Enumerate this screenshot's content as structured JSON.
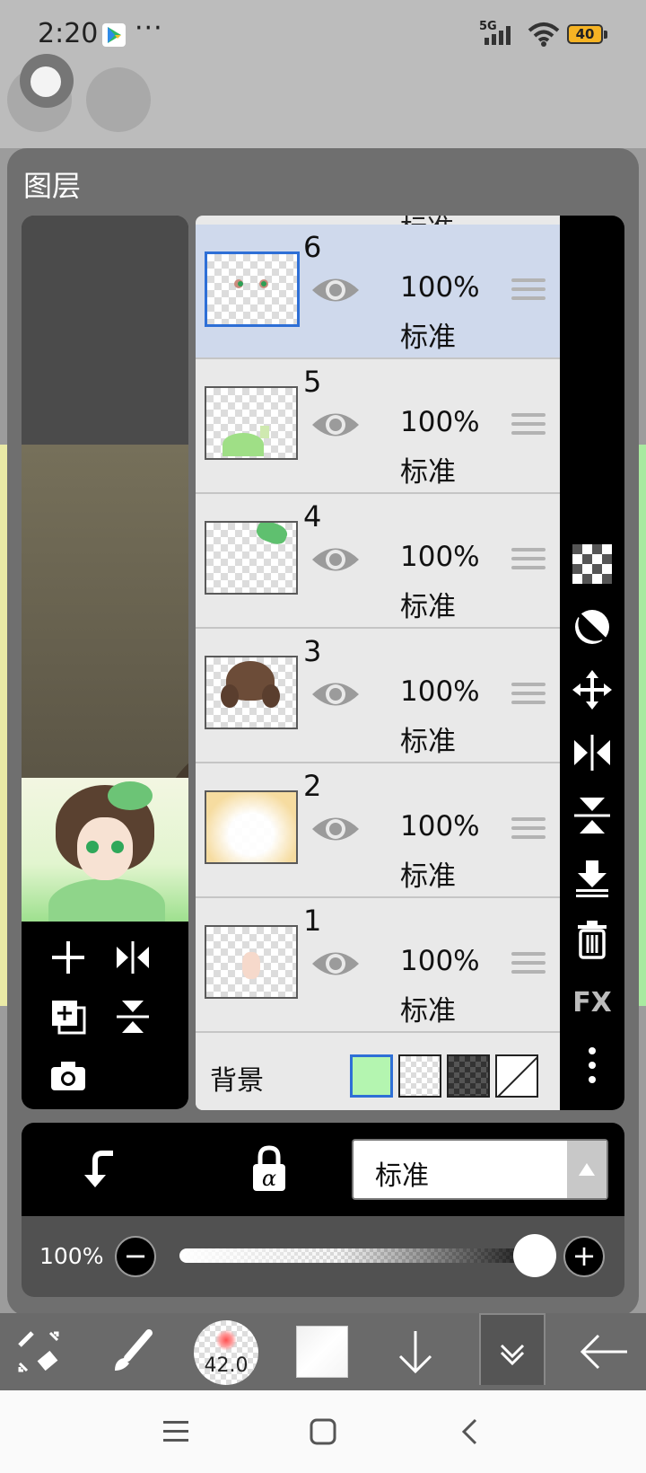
{
  "status_bar": {
    "time": "2:20",
    "more": "···",
    "network": "5G",
    "battery": "40"
  },
  "panel": {
    "title": "图层",
    "partial_layer_mode": "标准"
  },
  "layers": [
    {
      "num": "6",
      "opacity": "100%",
      "mode": "标准",
      "selected": true
    },
    {
      "num": "5",
      "opacity": "100%",
      "mode": "标准",
      "selected": false
    },
    {
      "num": "4",
      "opacity": "100%",
      "mode": "标准",
      "selected": false
    },
    {
      "num": "3",
      "opacity": "100%",
      "mode": "标准",
      "selected": false
    },
    {
      "num": "2",
      "opacity": "100%",
      "mode": "标准",
      "selected": false
    },
    {
      "num": "1",
      "opacity": "100%",
      "mode": "标准",
      "selected": false
    }
  ],
  "background_row": {
    "label": "背景",
    "selected_swatch": "green",
    "swatches": [
      "green",
      "checker-light",
      "checker-dark",
      "none"
    ]
  },
  "right_tools": {
    "fx_label": "FX"
  },
  "blend_mode": {
    "value": "标准"
  },
  "opacity": {
    "label": "100%",
    "value_fraction": 1.0
  },
  "toolbar": {
    "brush_size": "42.0"
  },
  "colors": {
    "selected_layer_bg": "#cfd9ec",
    "selection_border": "#2e6fd6",
    "panel_bg": "#6f6f6f",
    "bg_swatch_green": "#b4f5b0"
  }
}
